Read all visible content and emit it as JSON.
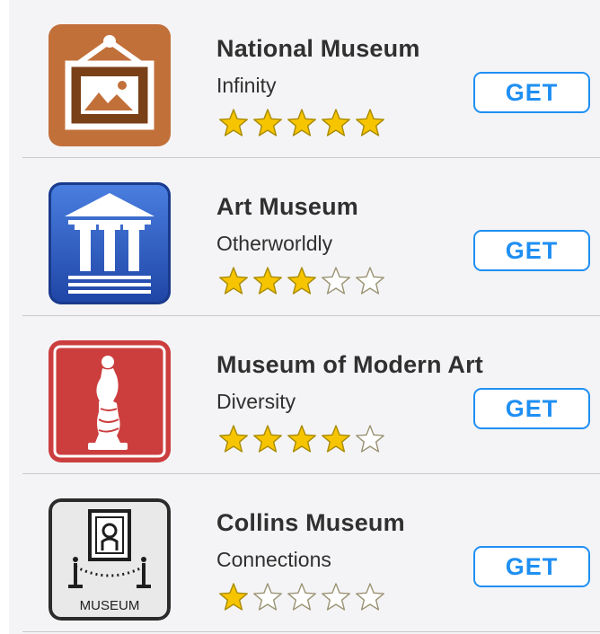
{
  "apps": [
    {
      "title": "National Museum",
      "subtitle": "Infinity",
      "rating": 5,
      "icon": "picture-frame-icon",
      "icon_bg": "#c2703a",
      "button_label": "GET"
    },
    {
      "title": "Art Museum",
      "subtitle": "Otherworldly",
      "rating": 3,
      "icon": "classical-building-icon",
      "icon_bg": "#2f5fc4",
      "button_label": "GET"
    },
    {
      "title": "Museum of Modern Art",
      "subtitle": "Diversity",
      "rating": 4,
      "icon": "statue-icon",
      "icon_bg": "#cc3e3e",
      "button_label": "GET"
    },
    {
      "title": "Collins Museum",
      "subtitle": "Connections",
      "rating": 1,
      "icon": "museum-exhibit-icon",
      "icon_bg": "#e9e9e9",
      "icon_text": "MUSEUM",
      "button_label": "GET"
    }
  ],
  "max_rating": 5,
  "colors": {
    "accent": "#1f8ff2",
    "star_filled": "#f7c500",
    "star_empty": "#ffffff",
    "text": "#303030"
  }
}
